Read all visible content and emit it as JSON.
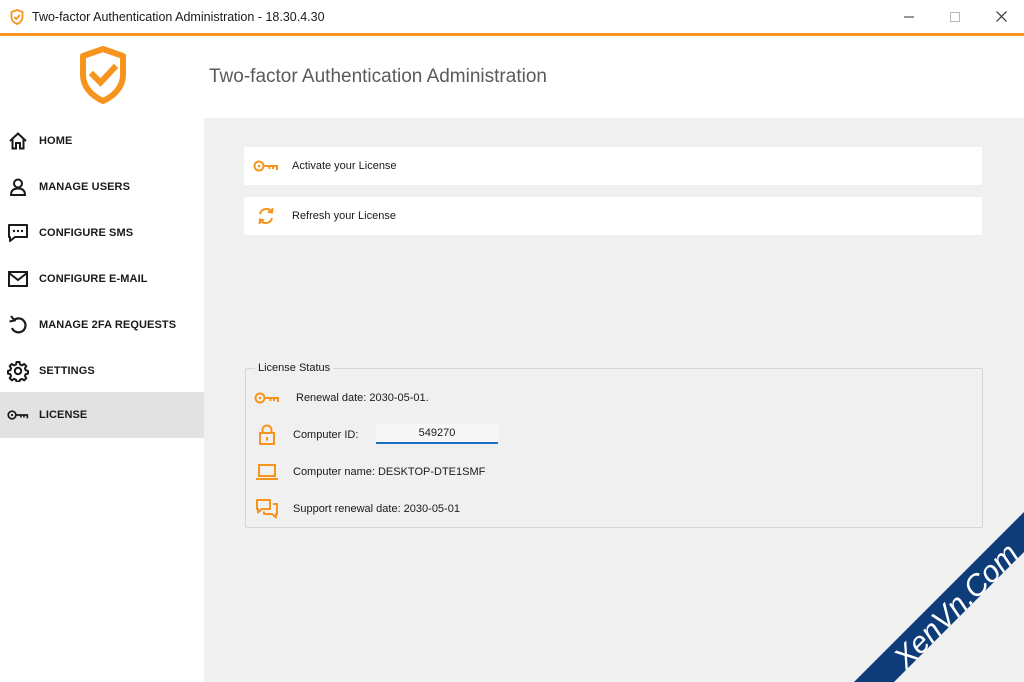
{
  "window": {
    "title": "Two-factor Authentication Administration - 18.30.4.30",
    "minimize_glyph": "—",
    "maximize_glyph": "☐",
    "close_glyph": "✕"
  },
  "header": {
    "title": "Two-factor Authentication Administration",
    "logo_icon": "shield-check-icon"
  },
  "sidebar": {
    "items": [
      {
        "label": "HOME",
        "icon": "home-icon",
        "active": false
      },
      {
        "label": "MANAGE USERS",
        "icon": "user-icon",
        "active": false
      },
      {
        "label": "CONFIGURE SMS",
        "icon": "sms-icon",
        "active": false
      },
      {
        "label": "CONFIGURE E-MAIL",
        "icon": "mail-icon",
        "active": false
      },
      {
        "label": "MANAGE 2FA REQUESTS",
        "icon": "undo-icon",
        "active": false
      },
      {
        "label": "SETTINGS",
        "icon": "gear-icon",
        "active": false
      },
      {
        "label": "LICENSE",
        "icon": "key-icon",
        "active": true
      }
    ]
  },
  "actions": {
    "activate_label": "Activate your License",
    "refresh_label": "Refresh your License"
  },
  "license_status": {
    "legend": "License Status",
    "renewal_date": "Renewal date: 2030-05-01.",
    "computer_id_label": "Computer ID:",
    "computer_id_value": "549270",
    "computer_name": "Computer name: DESKTOP-DTE1SMF",
    "support_renewal": "Support renewal date: 2030-05-01"
  },
  "watermark": {
    "text": "XenVn.Com"
  },
  "colors": {
    "accent": "#f7941d",
    "active_nav": "#e2e2e2",
    "content_bg": "#f0f0f0",
    "input_underline": "#1a6fc9",
    "watermark": "#0e3c78"
  }
}
